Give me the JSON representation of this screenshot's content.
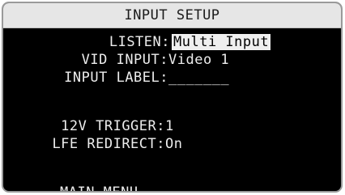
{
  "title": "INPUT SETUP",
  "rows": [
    {
      "label": "LISTEN:",
      "value": "Multi Input",
      "highlighted": true
    },
    {
      "label": "VID INPUT:",
      "value": "Video 1"
    },
    {
      "label": "INPUT LABEL:",
      "value": "_______"
    },
    {
      "label": "12V TRIGGER:",
      "value": "1"
    },
    {
      "label": "LFE REDIRECT:",
      "value": "On"
    }
  ],
  "main_menu_label": "MAIN MENU",
  "colors": {
    "screen_bg": "#000000",
    "title_bg": "#e6e6e6",
    "text": "#ededed",
    "highlight_bg": "#efefef",
    "highlight_text": "#000000",
    "border": "#9a9a9a"
  }
}
